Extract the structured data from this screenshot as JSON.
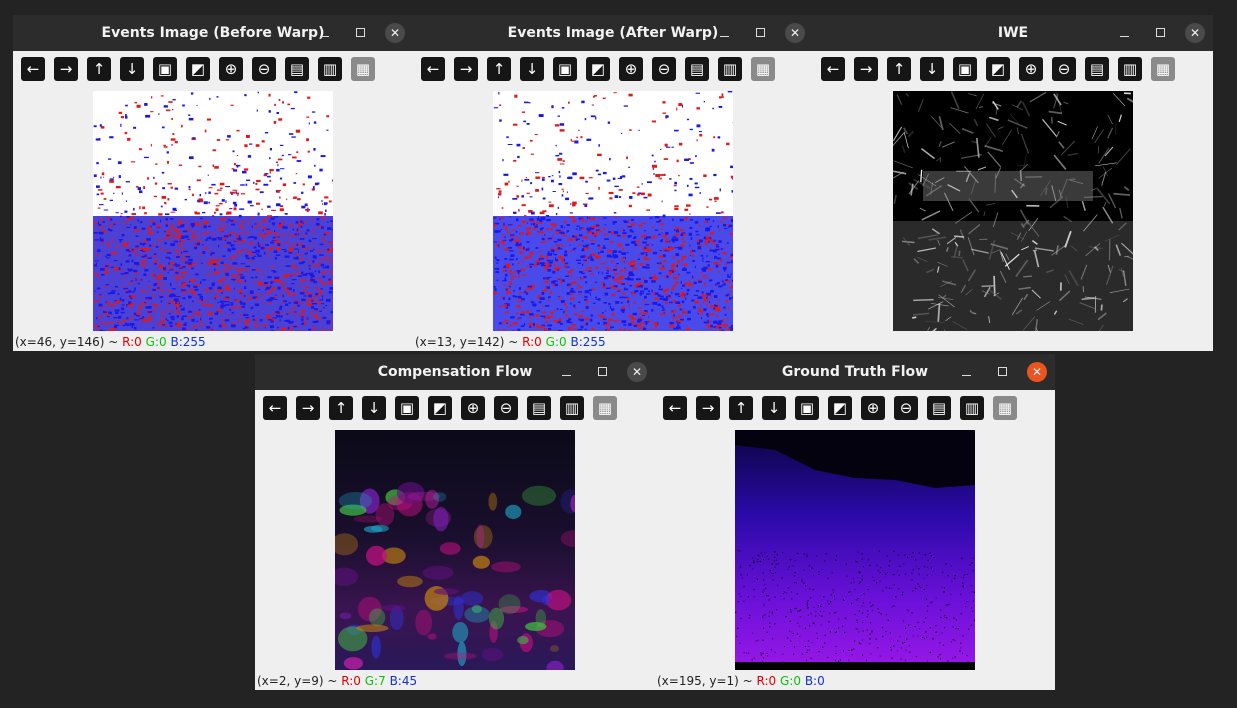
{
  "windows": [
    {
      "id": "before",
      "title": "Events Image (Before Warp)",
      "status": {
        "coords": "(x=46, y=146) ~ ",
        "r": "R:0",
        "g": "G:0",
        "b": "B:255"
      },
      "close_active": false
    },
    {
      "id": "after",
      "title": "Events Image (After Warp)",
      "status": {
        "coords": "(x=13, y=142) ~ ",
        "r": "R:0",
        "g": "G:0",
        "b": "B:255"
      },
      "close_active": false
    },
    {
      "id": "iwe",
      "title": "IWE",
      "status": null,
      "close_active": false
    },
    {
      "id": "compensation",
      "title": "Compensation Flow",
      "status": {
        "coords": "(x=2, y=9) ~ ",
        "r": "R:0",
        "g": "G:7",
        "b": "B:45"
      },
      "close_active": false
    },
    {
      "id": "groundtruth",
      "title": "Ground Truth Flow",
      "status": {
        "coords": "(x=195, y=1) ~ ",
        "r": "R:0",
        "g": "G:0",
        "b": "B:0"
      },
      "close_active": true
    }
  ],
  "toolbar_icons": [
    "arrow-left-icon",
    "arrow-right-icon",
    "arrow-up-icon",
    "arrow-down-icon",
    "image-icon",
    "image-settings-icon",
    "zoom-in-icon",
    "zoom-out-icon",
    "save-icon",
    "clipboard-icon",
    "properties-icon"
  ],
  "colors": {
    "desktop_bg": "#232323",
    "titlebar_bg": "#2c2c2c",
    "window_bg": "#efefef",
    "close_active": "#e95420",
    "event_red": "#e01818",
    "event_blue": "#1818e8"
  }
}
